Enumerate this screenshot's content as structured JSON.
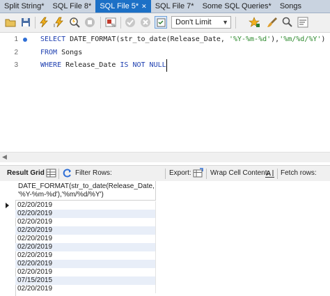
{
  "tabs": [
    {
      "label": "Split String*",
      "active": false
    },
    {
      "label": "SQL File 8*",
      "active": false
    },
    {
      "label": "SQL File 5*",
      "active": true
    },
    {
      "label": "SQL File 7*",
      "active": false
    },
    {
      "label": "Some SQL Queries*",
      "active": false
    },
    {
      "label": "Songs",
      "active": false
    }
  ],
  "toolbar": {
    "limit_value": "Don't Limit",
    "icons": [
      "folder-open-icon",
      "save-icon",
      "execute-icon",
      "execute-statement-icon",
      "explain-icon",
      "stop-icon",
      "toggle-autocommit-icon",
      "commit-icon",
      "rollback-icon",
      "toggle-output-icon",
      "bookmark-star-icon",
      "brush-icon",
      "find-icon",
      "wrap-icon"
    ]
  },
  "editor": {
    "lines": [
      {
        "num": "1",
        "tokens": [
          {
            "t": "SELECT",
            "k": "kw"
          },
          {
            "t": " DATE_FORMAT(str_to_date(Release_Date, ",
            "k": ""
          },
          {
            "t": "'%Y-%m-%d'",
            "k": "str"
          },
          {
            "t": "),",
            "k": ""
          },
          {
            "t": "'%m/%d/%Y'",
            "k": "str"
          },
          {
            "t": ")",
            "k": ""
          }
        ]
      },
      {
        "num": "2",
        "tokens": [
          {
            "t": "FROM",
            "k": "kw"
          },
          {
            "t": " Songs",
            "k": ""
          }
        ]
      },
      {
        "num": "3",
        "tokens": [
          {
            "t": "WHERE",
            "k": "kw"
          },
          {
            "t": " Release_Date ",
            "k": ""
          },
          {
            "t": "IS NOT NULL",
            "k": "kw"
          }
        ]
      }
    ]
  },
  "result_toolbar": {
    "result_grid": "Result Grid",
    "filter_rows": "Filter Rows:",
    "export": "Export:",
    "wrap_cell": "Wrap Cell Content:",
    "fetch_rows": "Fetch rows:"
  },
  "grid": {
    "column_header": "DATE_FORMAT(str_to_date(Release_Date, '%Y-%m-%d'),'%m/%d/%Y')",
    "rows": [
      "02/20/2019",
      "02/20/2019",
      "02/20/2019",
      "02/20/2019",
      "02/20/2019",
      "02/20/2019",
      "02/20/2019",
      "02/20/2019",
      "02/20/2019",
      "07/15/2015",
      "02/20/2019"
    ]
  },
  "colors": {
    "tab_active": "#1c70c6",
    "keyword": "#1e3fb0",
    "string": "#2d8a2d",
    "row_alt": "#e8eef8"
  }
}
